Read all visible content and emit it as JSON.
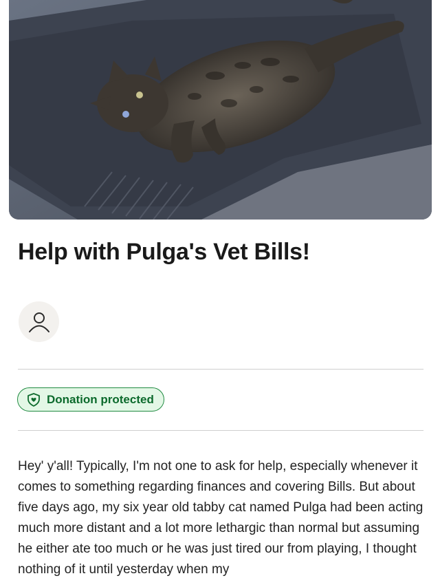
{
  "campaign": {
    "title": "Help with Pulga's Vet Bills!",
    "hero_image": "photo of a tabby cat lying on a grey blanket"
  },
  "organizer": {
    "avatar_icon": "user-icon"
  },
  "badge": {
    "label": "Donation protected",
    "icon": "shield-heart-icon",
    "color_border": "#1f8a40",
    "color_background": "#e3f7e6",
    "color_text": "#0c6a2c"
  },
  "story": {
    "text": "Hey' y'all! Typically, I'm not one to ask for help, especially whenever it comes to something regarding finances and covering Bills. But about five days ago, my six year old tabby cat named Pulga had been acting much more distant and a lot more lethargic than normal but assuming he either ate too much or he was just tired our from playing, I thought nothing of it until yesterday when my"
  }
}
